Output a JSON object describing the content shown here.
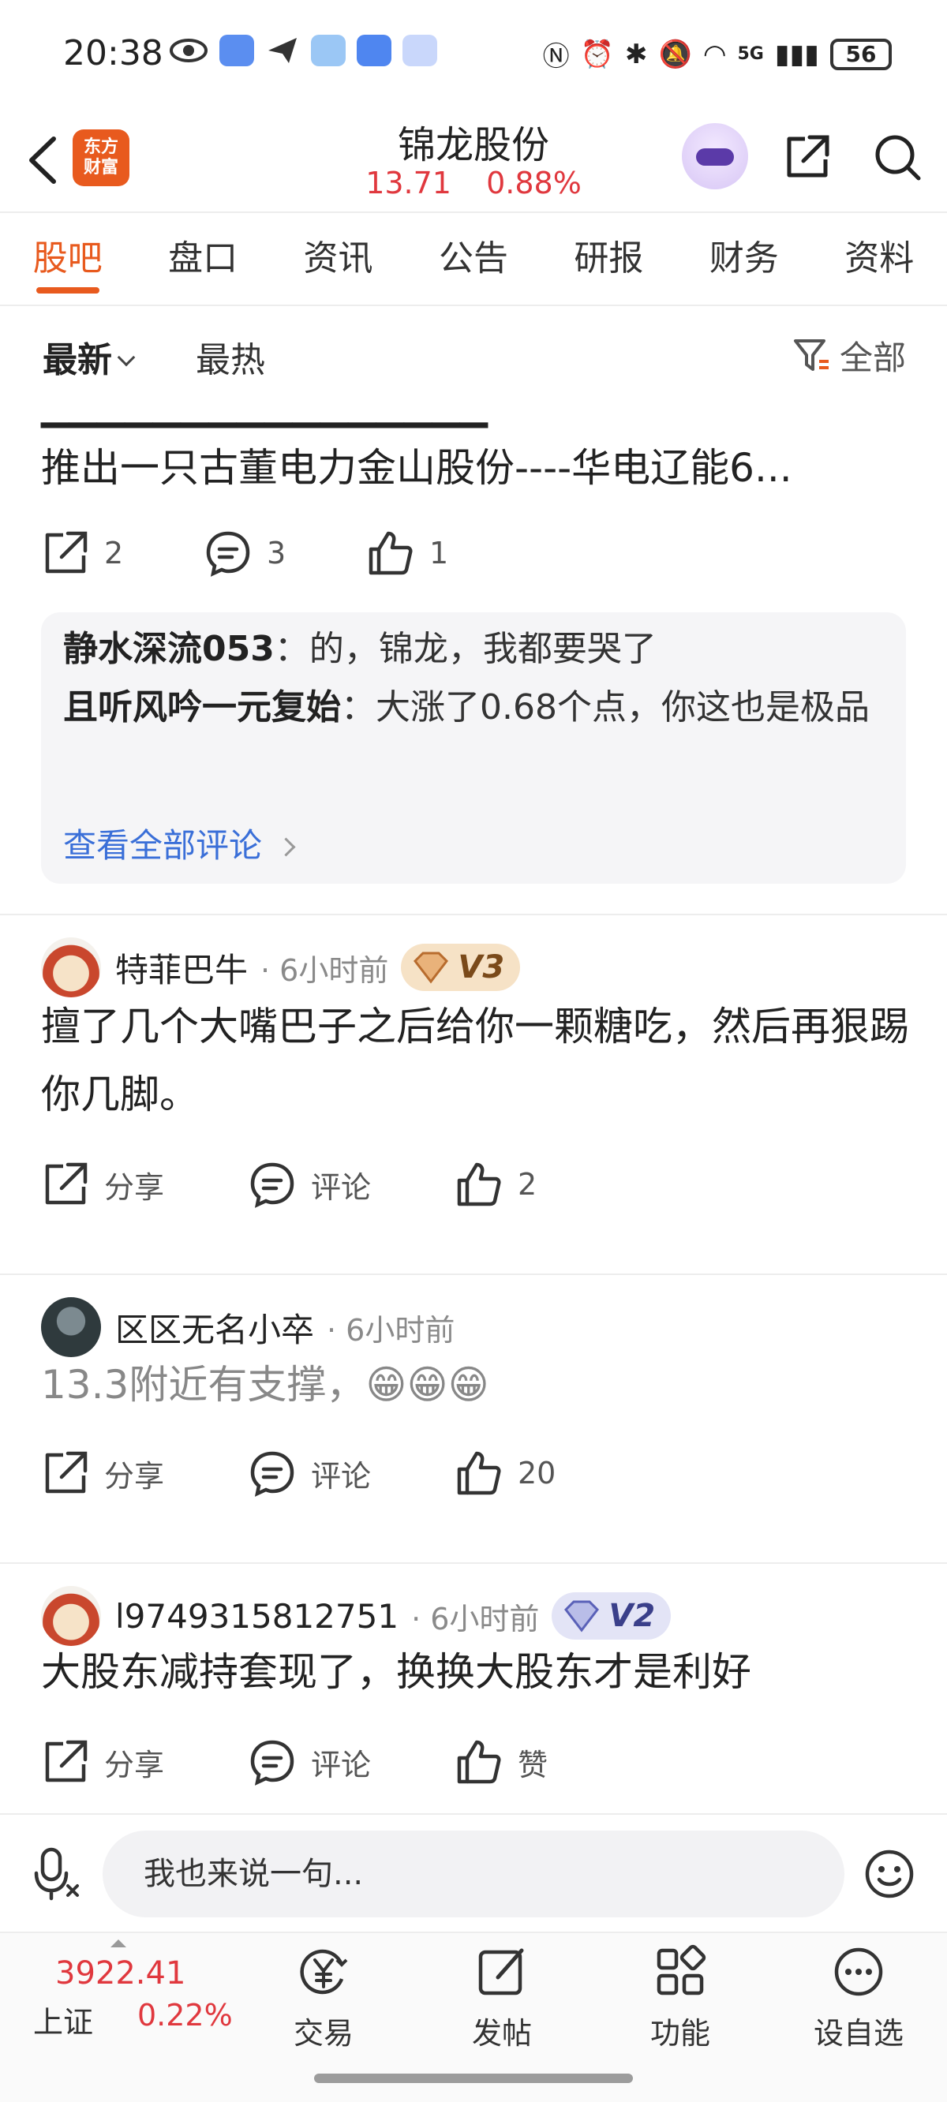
{
  "status_bar": {
    "time": "20:38",
    "battery": "56",
    "network": "5G"
  },
  "header": {
    "logo_line1": "东方",
    "logo_line2": "财富",
    "title": "锦龙股份",
    "price": "13.71",
    "change_pct": "0.88%"
  },
  "tabs": [
    "股吧",
    "盘口",
    "资讯",
    "公告",
    "研报",
    "财务",
    "资料"
  ],
  "filter": {
    "latest": "最新",
    "hot": "最热",
    "all": "全部"
  },
  "post1": {
    "text": "推出一只古董电力金山股份----华电辽能6...",
    "shares": "2",
    "comments": "3",
    "likes": "1",
    "comment_preview": [
      {
        "user": "静水深流053",
        "text": "：的，锦龙，我都要哭了"
      },
      {
        "user": "且听风吟一元复始",
        "text": "：大涨了0.68个点，你这也是极品"
      }
    ],
    "view_all": "查看全部评论"
  },
  "posts": [
    {
      "user": "特菲巴牛",
      "time": "· 6小时前",
      "badge": "V3",
      "text": "擅了几个大嘴巴子之后给你一颗糖吃，然后再狠踢你几脚。",
      "share": "分享",
      "comment": "评论",
      "like": "2"
    },
    {
      "user": "区区无名小卒",
      "time": "· 6小时前",
      "text": "13.3附近有支撑，😁😁😁",
      "share": "分享",
      "comment": "评论",
      "like": "20"
    },
    {
      "user": "l9749315812751",
      "time": "· 6小时前",
      "badge": "V2",
      "text": "大股东减持套现了，换换大股东才是利好",
      "share": "分享",
      "comment": "评论",
      "like": "赞"
    }
  ],
  "input": {
    "placeholder": "我也来说一句..."
  },
  "bottom_nav": {
    "index_value": "3922.41",
    "index_name": "上证",
    "index_pct": "0.22%",
    "items": [
      "交易",
      "发帖",
      "功能",
      "设自选"
    ]
  },
  "colors": {
    "accent": "#e85a1e",
    "up_red": "#e0383e",
    "link_blue": "#3a6fd8"
  }
}
